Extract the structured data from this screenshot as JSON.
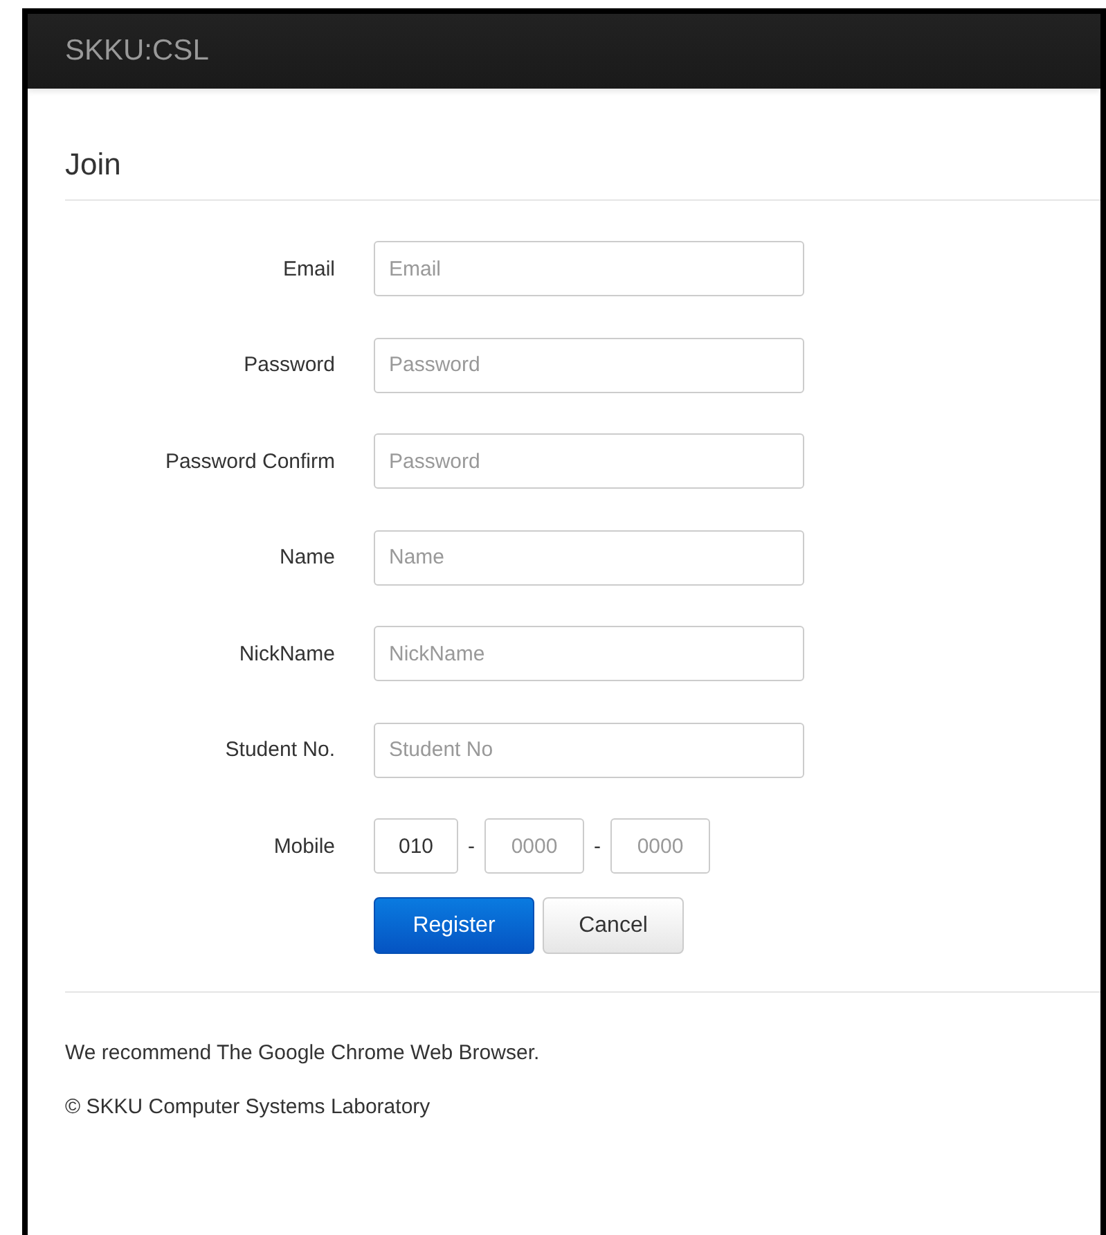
{
  "navbar": {
    "brand": "SKKU:CSL"
  },
  "heading": "Join",
  "form": {
    "fields": [
      {
        "kind": "text",
        "label": "Email",
        "placeholder": "Email"
      },
      {
        "kind": "text",
        "label": "Password",
        "placeholder": "Password"
      },
      {
        "kind": "text",
        "label": "Password Confirm",
        "placeholder": "Password"
      },
      {
        "kind": "text",
        "label": "Name",
        "placeholder": "Name"
      },
      {
        "kind": "text",
        "label": "NickName",
        "placeholder": "NickName"
      },
      {
        "kind": "text",
        "label": "Student No.",
        "placeholder": "Student No"
      },
      {
        "kind": "phone",
        "label": "Mobile",
        "parts": [
          {
            "value": "010"
          },
          {
            "placeholder": "0000"
          },
          {
            "placeholder": "0000"
          }
        ],
        "separators": [
          "-",
          "-"
        ]
      }
    ],
    "buttons": [
      {
        "kind": "primary",
        "label": "Register"
      },
      {
        "kind": "default",
        "label": "Cancel"
      }
    ]
  },
  "footer": [
    "We recommend The Google Chrome Web Browser.",
    "© SKKU Computer Systems Laboratory"
  ]
}
